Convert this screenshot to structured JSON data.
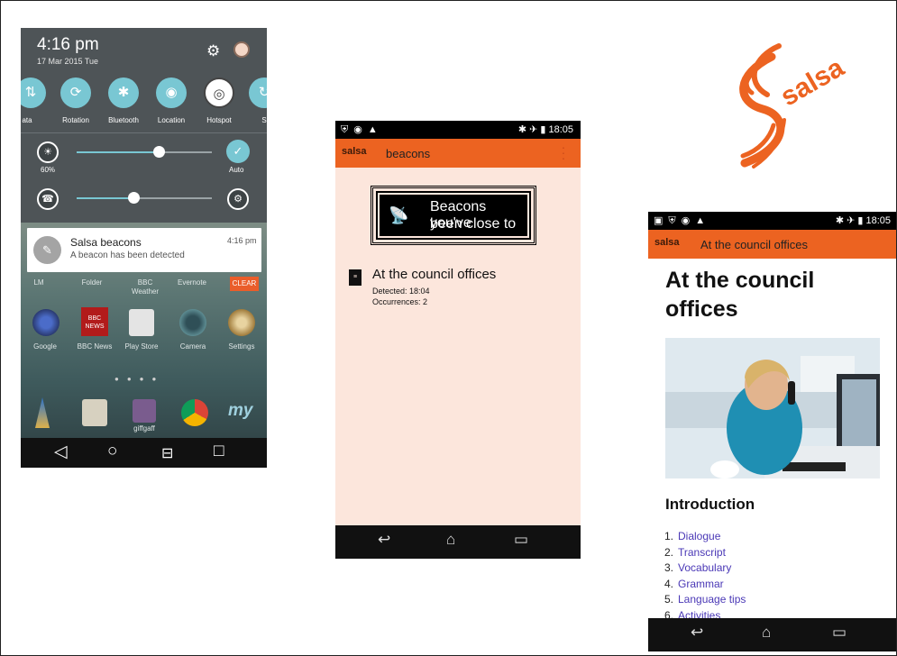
{
  "phone1": {
    "time": "4:16 pm",
    "date": "17 Mar 2015 Tue",
    "quick_settings": [
      "ata",
      "Rotation",
      "Bluetooth",
      "Location",
      "Hotspot",
      "S"
    ],
    "brightness_value": "60%",
    "brightness_level": 0.62,
    "auto_label": "Auto",
    "volume_level": 0.44,
    "notification": {
      "title": "Salsa beacons",
      "body": "A beacon has been detected",
      "time": "4:16 pm"
    },
    "clear_label": "CLEAR",
    "home_row1": [
      "LM",
      "Folder",
      "BBC\nWeather",
      "Evernote"
    ],
    "home_row2": [
      "Google",
      "BBC News",
      "Play Store",
      "Camera",
      "Settings"
    ],
    "bbc_icon_text": "BBC\nNEWS",
    "dock_label": "giffgaff",
    "my_icon_text": "my"
  },
  "phone2": {
    "status_time": "18:05",
    "app_logo": "salsa",
    "app_title": "beacons",
    "button_line1": "Beacons you've",
    "button_line2": "been close to",
    "entry_title": "At the council offices",
    "detected": "Detected: 18:04",
    "occurrences": "Occurrences: 2"
  },
  "logo_text": "salsa",
  "phone3": {
    "status_time": "18:05",
    "app_logo": "salsa",
    "app_title": "At the council offices",
    "heading": "At the council offices",
    "section_title": "Introduction",
    "list": [
      {
        "num": "1.",
        "label": "Dialogue"
      },
      {
        "num": "2.",
        "label": "Transcript"
      },
      {
        "num": "3.",
        "label": "Vocabulary"
      },
      {
        "num": "4.",
        "label": "Grammar"
      },
      {
        "num": "5.",
        "label": "Language tips"
      },
      {
        "num": "6.",
        "label": "Activities"
      }
    ]
  },
  "colors": {
    "accent_orange": "#ec6321",
    "teal": "#79c7d3",
    "link_purple": "#4a38b6",
    "peach_bg": "#fce6dc"
  }
}
